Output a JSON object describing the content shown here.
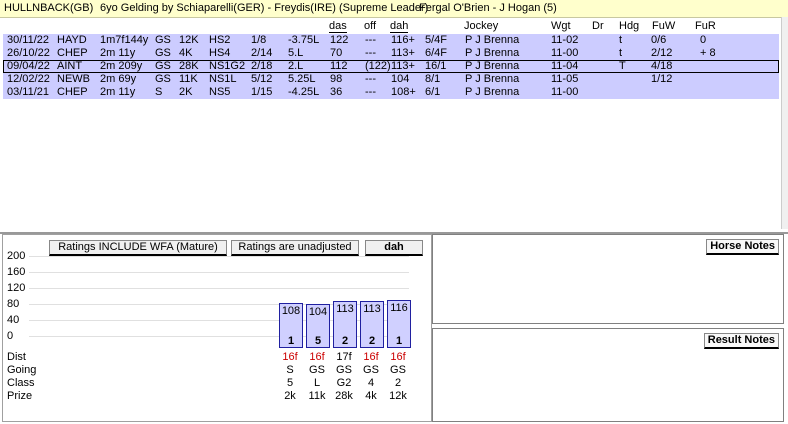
{
  "header": {
    "horse": "HULLNBACK(GB)",
    "breeding": "6yo Gelding by Schiaparelli(GER) - Freydis(IRE) (Supreme Leader)",
    "connections": "Fergal O'Brien  -  J Hogan (5)"
  },
  "columns": {
    "das": "das",
    "off": "off",
    "dah": "dah",
    "jockey": "Jockey",
    "wgt": "Wgt",
    "dr": "Dr",
    "hdg": "Hdg",
    "fuw": "FuW",
    "fur": "FuR"
  },
  "runs": [
    {
      "date": "30/11/22",
      "course": "HAYD",
      "dist": "1m7f144y",
      "going": "GS",
      "prize": "12K",
      "class": "HS2",
      "pos": "1/8",
      "btn": "-3.75L",
      "das": "122",
      "off": "---",
      "dah": "116+",
      "sp": "5/4F",
      "jockey": "P J Brenna",
      "wgt": "11-02",
      "dr": "",
      "hdg": "t",
      "fuw": "0/6",
      "fur": "0"
    },
    {
      "date": "26/10/22",
      "course": "CHEP",
      "dist": "2m  11y",
      "going": "GS",
      "prize": "4K",
      "class": "HS4",
      "pos": "2/14",
      "btn": "5.L",
      "das": "70",
      "off": "---",
      "dah": "113+",
      "sp": "6/4F",
      "jockey": "P J Brenna",
      "wgt": "11-00",
      "dr": "",
      "hdg": "t",
      "fuw": "2/12",
      "fur": "+ 8"
    },
    {
      "date": "09/04/22",
      "course": "AINT",
      "dist": "2m 209y",
      "going": "GS",
      "prize": "28K",
      "class": "NS1G2",
      "pos": "2/18",
      "btn": "2.L",
      "das": "112",
      "off": "(122)",
      "dah": "113+",
      "sp": "16/1",
      "jockey": "P J Brenna",
      "wgt": "11-04",
      "dr": "",
      "hdg": "T",
      "fuw": "4/18",
      "fur": ""
    },
    {
      "date": "12/02/22",
      "course": "NEWB",
      "dist": "2m  69y",
      "going": "GS",
      "prize": "11K",
      "class": "NS1L",
      "pos": "5/12",
      "btn": "5.25L",
      "das": "98",
      "off": "---",
      "dah": "104",
      "sp": "8/1",
      "jockey": "P J Brenna",
      "wgt": "11-05",
      "dr": "",
      "hdg": "",
      "fuw": "1/12",
      "fur": ""
    },
    {
      "date": "03/11/21",
      "course": "CHEP",
      "dist": "2m  11y",
      "going": "S",
      "prize": "2K",
      "class": "NS5",
      "pos": "1/15",
      "btn": "-4.25L",
      "das": "36",
      "off": "---",
      "dah": "108+",
      "sp": "6/1",
      "jockey": "P J Brenna",
      "wgt": "11-00",
      "dr": "",
      "hdg": "",
      "fuw": "",
      "fur": ""
    }
  ],
  "chart_buttons": {
    "wfa": "Ratings INCLUDE WFA (Mature)",
    "adjusted": "Ratings are unadjusted",
    "metric": "dah"
  },
  "chart_data": {
    "type": "bar",
    "ylim": [
      0,
      200
    ],
    "yticks": [
      "200",
      "160",
      "120",
      "80",
      "40",
      "0"
    ],
    "bars": [
      {
        "rating": 108,
        "label": "108",
        "pos": "1"
      },
      {
        "rating": 104,
        "label": "104",
        "pos": "5"
      },
      {
        "rating": 113,
        "label": "113",
        "pos": "2"
      },
      {
        "rating": 113,
        "label": "113",
        "pos": "2"
      },
      {
        "rating": 116,
        "label": "116",
        "pos": "1"
      }
    ],
    "row_labels": {
      "dist": "Dist",
      "going": "Going",
      "class": "Class",
      "prize": "Prize"
    },
    "dist": [
      "16f",
      "16f",
      "17f",
      "16f",
      "16f"
    ],
    "dist_colors": [
      "#cc0000",
      "#cc0000",
      "#000000",
      "#cc0000",
      "#cc0000"
    ],
    "going": [
      "S",
      "GS",
      "GS",
      "GS",
      "GS"
    ],
    "class": [
      "5",
      "L",
      "G2",
      "4",
      "2"
    ],
    "prize": [
      "2k",
      "11k",
      "28k",
      "4k",
      "12k"
    ]
  },
  "notes": {
    "horse": "Horse Notes",
    "result": "Result Notes"
  }
}
